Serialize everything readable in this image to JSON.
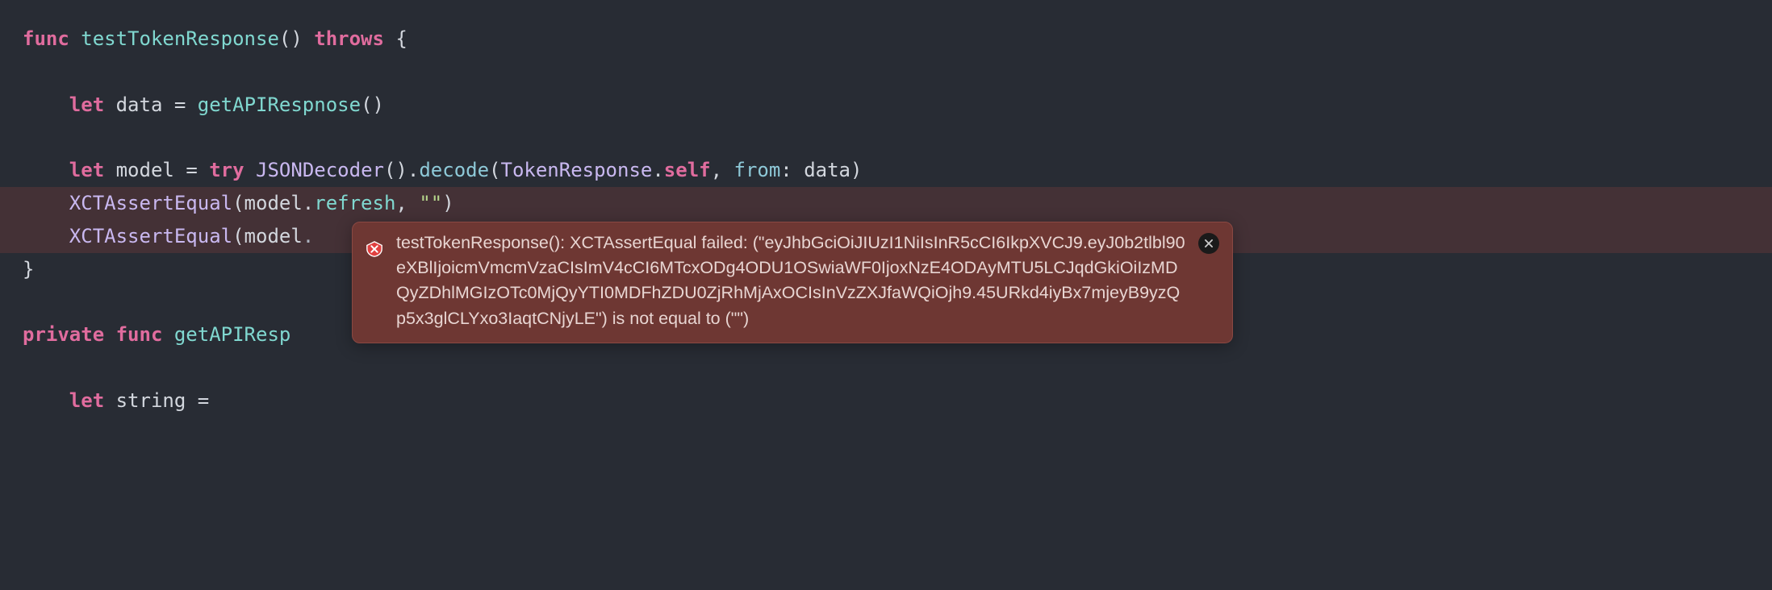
{
  "code": {
    "line1": {
      "func": "func",
      "name": "testTokenResponse",
      "parens": "()",
      "throws": "throws",
      "brace": " {"
    },
    "line3": {
      "indent": "    ",
      "let": "let",
      "var": " data ",
      "eq": "=",
      "space": " ",
      "call": "getAPIRespnose",
      "parens": "()"
    },
    "line5": {
      "indent": "    ",
      "let": "let",
      "var": " model ",
      "eq": "=",
      "space": " ",
      "try": "try",
      "space2": " ",
      "type": "JSONDecoder",
      "parens": "()",
      "dot": ".",
      "method": "decode",
      "open": "(",
      "type2": "TokenResponse",
      "dot2": ".",
      "self": "self",
      "comma": ", ",
      "from": "from",
      "colon": ": ",
      "arg": "data",
      "close": ")"
    },
    "line6": {
      "indent": "    ",
      "fn": "XCTAssertEqual",
      "open": "(",
      "arg1": "model",
      "dot": ".",
      "prop": "refresh",
      "comma": ", ",
      "str": "\"\"",
      "close": ")"
    },
    "line7": {
      "indent": "    ",
      "fn": "XCTAssertEqual",
      "open": "(",
      "arg1": "model",
      "partial": "."
    },
    "line8": {
      "brace": "}"
    },
    "line10": {
      "private": "private",
      "space": " ",
      "func": "func",
      "space2": " ",
      "name": "getAPIResp"
    },
    "line12": {
      "indent": "    ",
      "let": "let",
      "var": " string ",
      "eq": "="
    }
  },
  "error": {
    "message": "testTokenResponse(): XCTAssertEqual failed: (\"eyJhbGciOiJIUzI1NiIsInR5cCI6IkpXVCJ9.eyJ0b2tlbl90eXBlIjoicmVmcmVzaCIsImV4cCI6MTcxODg4ODU1OSwiaWF0IjoxNzE4ODAyMTU5LCJqdGkiOiIzMDQyZDhlMGIzOTc0MjQyYTI0MDFhZDU0ZjRhMjAxOCIsInVzZXJfaWQiOjh9.45URkd4iyBx7mjeyB9yzQp5x3glCLYxo3IaqtCNjyLE\") is not equal to (\"\")"
  }
}
